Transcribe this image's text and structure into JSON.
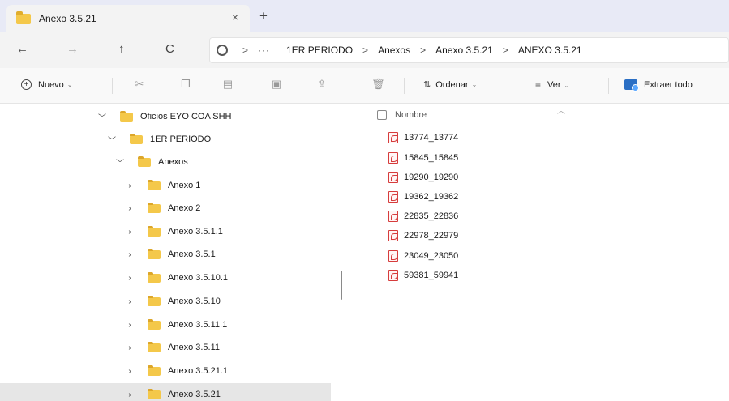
{
  "tab": {
    "title": "Anexo 3.5.21",
    "close": "×",
    "new_tab": "+"
  },
  "nav": {
    "back": "←",
    "forward": "→",
    "up": "↑",
    "refresh": "C"
  },
  "address": {
    "ellipsis": "···",
    "crumbs": [
      "1ER PERIODO",
      "Anexos",
      "Anexo 3.5.21",
      "ANEXO 3.5.21"
    ],
    "separator": ">"
  },
  "toolbar": {
    "new_label": "Nuevo",
    "sort_label": "Ordenar",
    "view_label": "Ver",
    "extract_label": "Extraer todo"
  },
  "tree": [
    {
      "label": "Oficios EYO COA SHH",
      "expanded": true
    },
    {
      "label": "1ER PERIODO",
      "expanded": true
    },
    {
      "label": "Anexos",
      "expanded": true
    },
    {
      "label": "Anexo 1",
      "expanded": false
    },
    {
      "label": "Anexo 2",
      "expanded": false
    },
    {
      "label": "Anexo 3.5.1.1",
      "expanded": false
    },
    {
      "label": "Anexo 3.5.1",
      "expanded": false
    },
    {
      "label": "Anexo 3.5.10.1",
      "expanded": false
    },
    {
      "label": "Anexo 3.5.10",
      "expanded": false
    },
    {
      "label": "Anexo 3.5.11.1",
      "expanded": false
    },
    {
      "label": "Anexo 3.5.11",
      "expanded": false
    },
    {
      "label": "Anexo 3.5.21.1",
      "expanded": false
    },
    {
      "label": "Anexo 3.5.21",
      "expanded": false,
      "selected": true
    }
  ],
  "list": {
    "column_name": "Nombre",
    "files": [
      "13774_13774",
      "15845_15845",
      "19290_19290",
      "19362_19362",
      "22835_22836",
      "22978_22979",
      "23049_23050",
      "59381_59941"
    ]
  },
  "colors": {
    "folder": "#f4c84a",
    "pdf": "#d63c3c",
    "tabbar": "#e8eaf6",
    "selected": "#e6e6e6"
  }
}
